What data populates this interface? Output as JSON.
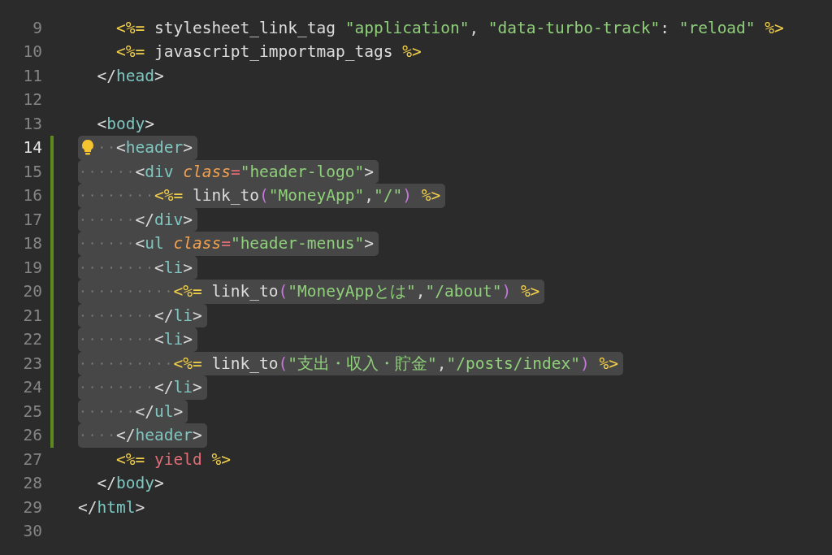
{
  "editor": {
    "lines": [
      {
        "number": "9",
        "tokens": [
          {
            "kind": "erb",
            "text": "    <%="
          },
          {
            "kind": "fn",
            "text": " stylesheet_link_tag "
          },
          {
            "kind": "str",
            "text": "\"application\""
          },
          {
            "kind": "text",
            "text": ", "
          },
          {
            "kind": "str",
            "text": "\"data-turbo-track\""
          },
          {
            "kind": "text",
            "text": ": "
          },
          {
            "kind": "str",
            "text": "\"reload\""
          },
          {
            "kind": "erb",
            "text": " %>"
          }
        ],
        "selected": false,
        "current": false,
        "modified": false,
        "lightbulb": false
      },
      {
        "number": "10",
        "tokens": [
          {
            "kind": "erb",
            "text": "    <%="
          },
          {
            "kind": "fn",
            "text": " javascript_importmap_tags "
          },
          {
            "kind": "erb",
            "text": "%>"
          }
        ],
        "selected": false,
        "current": false,
        "modified": false,
        "lightbulb": false
      },
      {
        "number": "11",
        "tokens": [
          {
            "kind": "punct",
            "text": "  </"
          },
          {
            "kind": "tag",
            "text": "head"
          },
          {
            "kind": "punct",
            "text": ">"
          }
        ],
        "selected": false,
        "current": false,
        "modified": false,
        "lightbulb": false
      },
      {
        "number": "12",
        "selected": false,
        "current": false,
        "modified": false,
        "lightbulb": false
      },
      {
        "number": "13",
        "tokens": [
          {
            "kind": "punct",
            "text": "  <"
          },
          {
            "kind": "tag",
            "text": "body"
          },
          {
            "kind": "punct",
            "text": ">"
          }
        ],
        "selected": false,
        "current": false,
        "modified": false,
        "lightbulb": false
      },
      {
        "number": "14",
        "tokens": [
          {
            "kind": "punct",
            "text": "    <"
          },
          {
            "kind": "tag",
            "text": "header"
          },
          {
            "kind": "punct",
            "text": ">"
          }
        ],
        "selected": true,
        "current": true,
        "modified": true,
        "lightbulb": true
      },
      {
        "number": "15",
        "tokens": [
          {
            "kind": "punct",
            "text": "      <"
          },
          {
            "kind": "tag",
            "text": "div"
          },
          {
            "kind": "attr",
            "text": " class"
          },
          {
            "kind": "op",
            "text": "="
          },
          {
            "kind": "str",
            "text": "\"header-logo\""
          },
          {
            "kind": "punct",
            "text": ">"
          }
        ],
        "selected": true,
        "current": false,
        "modified": true,
        "lightbulb": false
      },
      {
        "number": "16",
        "tokens": [
          {
            "kind": "erb",
            "text": "        <%="
          },
          {
            "kind": "fn",
            "text": " link_to"
          },
          {
            "kind": "paren",
            "text": "("
          },
          {
            "kind": "str",
            "text": "\"MoneyApp\""
          },
          {
            "kind": "text",
            "text": ","
          },
          {
            "kind": "str",
            "text": "\"/\""
          },
          {
            "kind": "paren",
            "text": ")"
          },
          {
            "kind": "erb",
            "text": " %>"
          }
        ],
        "selected": true,
        "current": false,
        "modified": true,
        "lightbulb": false
      },
      {
        "number": "17",
        "tokens": [
          {
            "kind": "punct",
            "text": "      </"
          },
          {
            "kind": "tag",
            "text": "div"
          },
          {
            "kind": "punct",
            "text": ">"
          }
        ],
        "selected": true,
        "current": false,
        "modified": true,
        "lightbulb": false
      },
      {
        "number": "18",
        "tokens": [
          {
            "kind": "punct",
            "text": "      <"
          },
          {
            "kind": "tag",
            "text": "ul"
          },
          {
            "kind": "attr",
            "text": " class"
          },
          {
            "kind": "op",
            "text": "="
          },
          {
            "kind": "str",
            "text": "\"header-menus\""
          },
          {
            "kind": "punct",
            "text": ">"
          }
        ],
        "selected": true,
        "current": false,
        "modified": true,
        "lightbulb": false
      },
      {
        "number": "19",
        "tokens": [
          {
            "kind": "punct",
            "text": "        <"
          },
          {
            "kind": "tag",
            "text": "li"
          },
          {
            "kind": "punct",
            "text": ">"
          }
        ],
        "selected": true,
        "current": false,
        "modified": true,
        "lightbulb": false
      },
      {
        "number": "20",
        "tokens": [
          {
            "kind": "erb",
            "text": "          <%="
          },
          {
            "kind": "fn",
            "text": " link_to"
          },
          {
            "kind": "paren",
            "text": "("
          },
          {
            "kind": "str",
            "text": "\"MoneyAppとは\""
          },
          {
            "kind": "text",
            "text": ","
          },
          {
            "kind": "str",
            "text": "\"/about\""
          },
          {
            "kind": "paren",
            "text": ")"
          },
          {
            "kind": "erb",
            "text": " %>"
          }
        ],
        "selected": true,
        "current": false,
        "modified": true,
        "lightbulb": false
      },
      {
        "number": "21",
        "tokens": [
          {
            "kind": "punct",
            "text": "        </"
          },
          {
            "kind": "tag",
            "text": "li"
          },
          {
            "kind": "punct",
            "text": ">"
          }
        ],
        "selected": true,
        "current": false,
        "modified": true,
        "lightbulb": false
      },
      {
        "number": "22",
        "tokens": [
          {
            "kind": "punct",
            "text": "        <"
          },
          {
            "kind": "tag",
            "text": "li"
          },
          {
            "kind": "punct",
            "text": ">"
          }
        ],
        "selected": true,
        "current": false,
        "modified": true,
        "lightbulb": false
      },
      {
        "number": "23",
        "tokens": [
          {
            "kind": "erb",
            "text": "          <%="
          },
          {
            "kind": "fn",
            "text": " link_to"
          },
          {
            "kind": "paren",
            "text": "("
          },
          {
            "kind": "str",
            "text": "\"支出・収入・貯金\""
          },
          {
            "kind": "text",
            "text": ","
          },
          {
            "kind": "str",
            "text": "\"/posts/index\""
          },
          {
            "kind": "paren",
            "text": ")"
          },
          {
            "kind": "erb",
            "text": " %>"
          }
        ],
        "selected": true,
        "current": false,
        "modified": true,
        "lightbulb": false
      },
      {
        "number": "24",
        "tokens": [
          {
            "kind": "punct",
            "text": "        </"
          },
          {
            "kind": "tag",
            "text": "li"
          },
          {
            "kind": "punct",
            "text": ">"
          }
        ],
        "selected": true,
        "current": false,
        "modified": true,
        "lightbulb": false
      },
      {
        "number": "25",
        "tokens": [
          {
            "kind": "punct",
            "text": "      </"
          },
          {
            "kind": "tag",
            "text": "ul"
          },
          {
            "kind": "punct",
            "text": ">"
          }
        ],
        "selected": true,
        "current": false,
        "modified": true,
        "lightbulb": false
      },
      {
        "number": "26",
        "tokens": [
          {
            "kind": "punct",
            "text": "    </"
          },
          {
            "kind": "tag",
            "text": "header"
          },
          {
            "kind": "punct",
            "text": ">"
          }
        ],
        "selected": true,
        "current": false,
        "modified": true,
        "lightbulb": false
      },
      {
        "number": "27",
        "tokens": [
          {
            "kind": "erb",
            "text": "    <%="
          },
          {
            "kind": "kw",
            "text": " yield "
          },
          {
            "kind": "erb",
            "text": "%>"
          }
        ],
        "selected": false,
        "current": false,
        "modified": false,
        "lightbulb": false
      },
      {
        "number": "28",
        "tokens": [
          {
            "kind": "punct",
            "text": "  </"
          },
          {
            "kind": "tag",
            "text": "body"
          },
          {
            "kind": "punct",
            "text": ">"
          }
        ],
        "selected": false,
        "current": false,
        "modified": false,
        "lightbulb": false
      },
      {
        "number": "29",
        "tokens": [
          {
            "kind": "punct",
            "text": "</"
          },
          {
            "kind": "tag",
            "text": "html"
          },
          {
            "kind": "punct",
            "text": ">"
          }
        ],
        "selected": false,
        "current": false,
        "modified": false,
        "lightbulb": false
      },
      {
        "number": "30",
        "selected": false,
        "current": false,
        "modified": false,
        "lightbulb": false
      }
    ]
  }
}
